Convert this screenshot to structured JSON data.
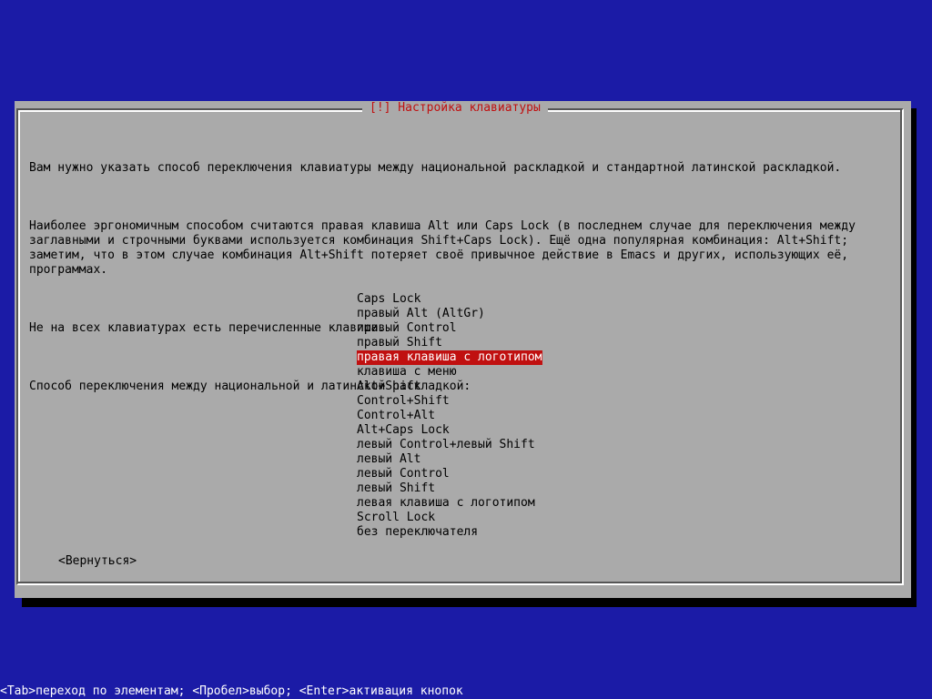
{
  "dialog": {
    "title": "[!] Настройка клавиатуры",
    "paragraphs": [
      "Вам нужно указать способ переключения клавиатуры между национальной раскладкой и стандартной латинской раскладкой.",
      "Наиболее эргономичным способом считаются правая клавиша Alt или Caps Lock (в последнем случае для переключения между\nзаглавными и строчными буквами используется комбинация Shift+Caps Lock). Ещё одна популярная комбинация: Alt+Shift;\nзаметим, что в этом случае комбинация Alt+Shift потеряет своё привычное действие в Emacs и других, использующих её,\nпрограммах.",
      "Не на всех клавиатурах есть перечисленные клавиши.",
      "Способ переключения между национальной и латинской раскладкой:"
    ],
    "options": [
      "Caps Lock",
      "правый Alt (AltGr)",
      "правый Control",
      "правый Shift",
      "правая клавиша с логотипом",
      "клавиша с меню",
      "Alt+Shift",
      "Control+Shift",
      "Control+Alt",
      "Alt+Caps Lock",
      "левый Control+левый Shift",
      "левый Alt",
      "левый Control",
      "левый Shift",
      "левая клавиша с логотипом",
      "Scroll Lock",
      "без переключателя"
    ],
    "selected_option": "правая клавиша с логотипом",
    "back_button": "<Вернуться>"
  },
  "help_bar": "<Tab>переход по элементам; <Пробел>выбор; <Enter>активация кнопок",
  "colors": {
    "background": "#1b1ba6",
    "dialog": "#aaaaaa",
    "accent": "#c01010"
  }
}
